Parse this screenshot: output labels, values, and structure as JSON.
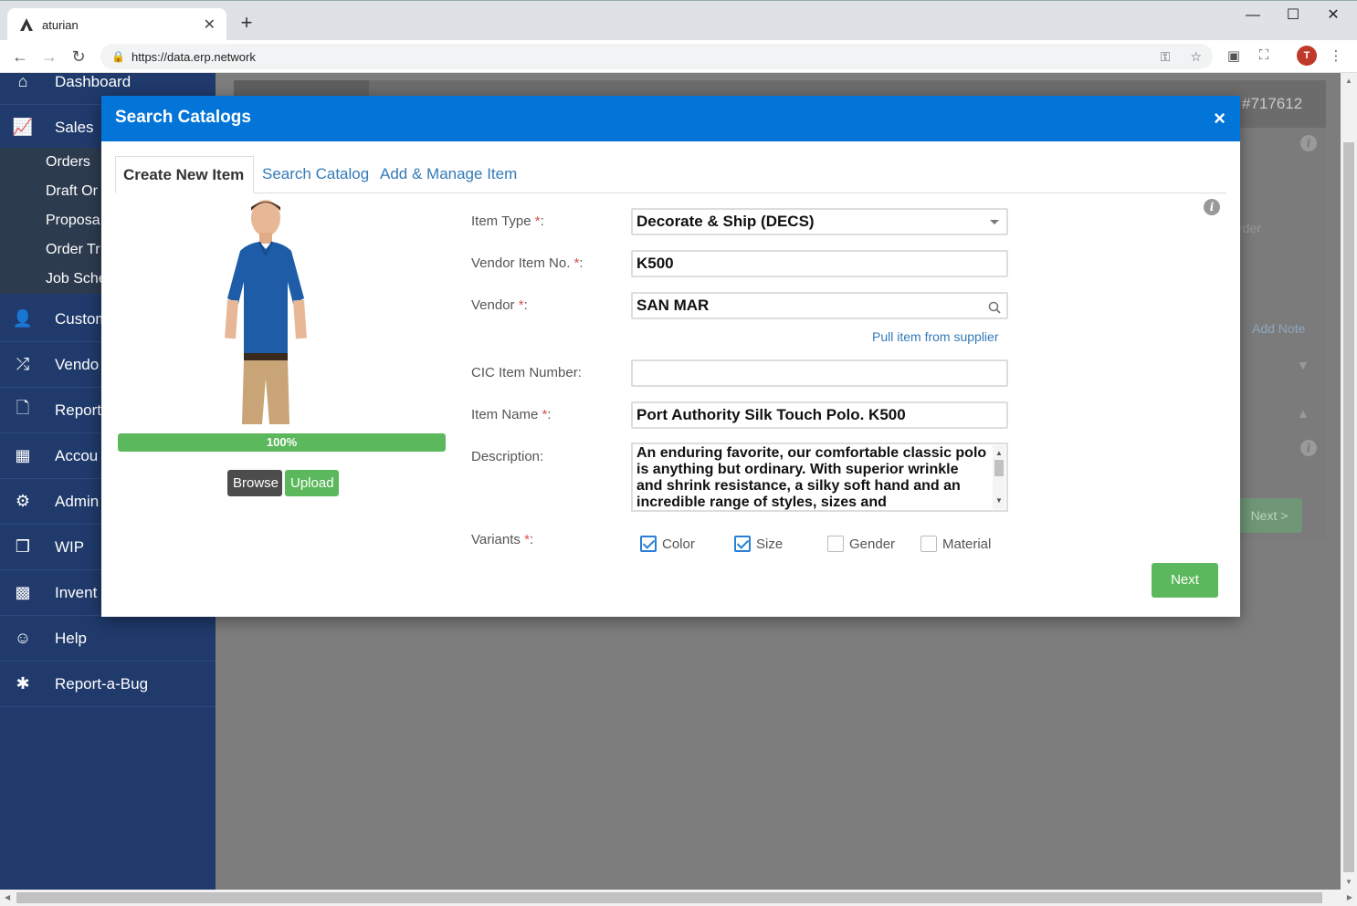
{
  "browser": {
    "tab_title": "aturian",
    "new_tab_symbol": "+",
    "url": "https://data.erp.network",
    "avatar_letter": "T"
  },
  "sidebar": {
    "items": [
      {
        "label": "Dashboard",
        "icon": "home-icon"
      },
      {
        "label": "Sales",
        "icon": "chart-icon"
      },
      {
        "label": "Custom",
        "icon": "user-icon"
      },
      {
        "label": "Vendo",
        "icon": "shuffle-icon"
      },
      {
        "label": "Report",
        "icon": "document-icon"
      },
      {
        "label": "Accou",
        "icon": "calculator-icon"
      },
      {
        "label": "Admin",
        "icon": "gear-icon"
      },
      {
        "label": "WIP",
        "icon": "cubes-icon"
      },
      {
        "label": "Invent",
        "icon": "grid-icon"
      },
      {
        "label": "Help",
        "icon": "smile-icon"
      },
      {
        "label": "Report-a-Bug",
        "icon": "bug-icon"
      }
    ],
    "sub_items": [
      "Orders",
      "Draft Or",
      "Proposa",
      "Order Tr",
      "Job Sche"
    ]
  },
  "background": {
    "order_number": "#717612",
    "order_text": "rder",
    "add_note": "Add Note",
    "next_label": "Next >"
  },
  "modal": {
    "title": "Search Catalogs",
    "close_symbol": "×",
    "tabs": [
      "Create New Item",
      "Search Catalog",
      "Add & Manage Item"
    ],
    "progress_percent": 100,
    "progress_label": "100%",
    "browse_label": "Browse",
    "upload_label": "Upload",
    "fields": {
      "item_type": {
        "label": "Item Type",
        "value": "Decorate & Ship (DECS)"
      },
      "vendor_item_no": {
        "label": "Vendor Item No.",
        "value": "K500"
      },
      "vendor": {
        "label": "Vendor",
        "value": "SAN MAR"
      },
      "pull_link": "Pull item from supplier",
      "cic_item_number": {
        "label": "CIC Item Number:",
        "value": ""
      },
      "item_name": {
        "label": "Item Name",
        "value": "Port Authority Silk Touch Polo. K500"
      },
      "description": {
        "label": "Description:",
        "value": "An enduring favorite, our comfortable classic polo is anything but ordinary. With superior wrinkle and shrink resistance, a silky soft hand and an incredible range of styles, sizes and"
      },
      "variants_label": "Variants"
    },
    "variants": [
      {
        "label": "Color",
        "checked": true
      },
      {
        "label": "Size",
        "checked": true
      },
      {
        "label": "Gender",
        "checked": false
      },
      {
        "label": "Material",
        "checked": false
      }
    ],
    "next_label": "Next"
  },
  "colors": {
    "modal_header": "#0375d8",
    "success": "#5cb85c",
    "link": "#337ab7",
    "required": "#d9534f"
  }
}
